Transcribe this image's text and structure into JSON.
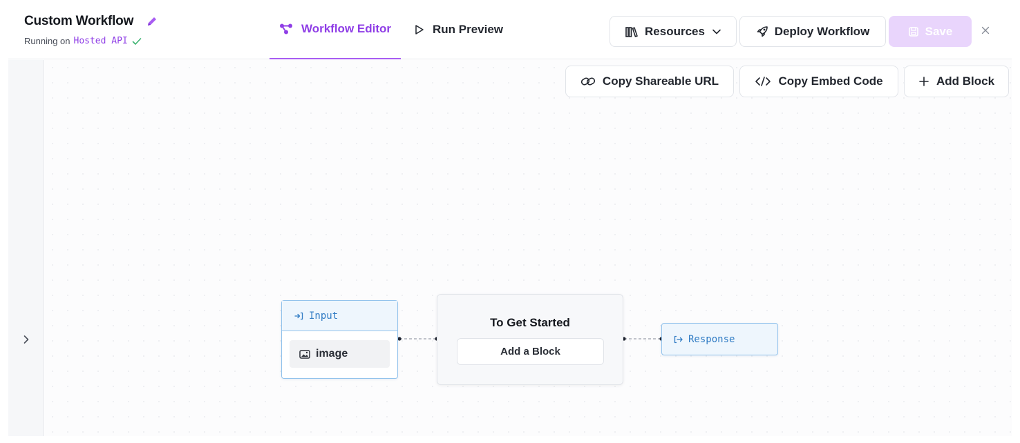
{
  "header": {
    "title": "Custom Workflow",
    "running_prefix": "Running on",
    "running_host": "Hosted API"
  },
  "tabs": [
    {
      "label": "Workflow Editor",
      "active": true
    },
    {
      "label": "Run Preview",
      "active": false
    }
  ],
  "actions": {
    "resources_label": "Resources",
    "deploy_label": "Deploy Workflow",
    "save_label": "Save"
  },
  "toolbar": {
    "share_label": "Copy Shareable URL",
    "embed_label": "Copy Embed Code",
    "add_block_label": "Add Block"
  },
  "nodes": {
    "input": {
      "title": "Input",
      "param": "image"
    },
    "start": {
      "title": "To Get Started",
      "button": "Add a Block"
    },
    "response": {
      "title": "Response"
    }
  },
  "colors": {
    "accent": "#8f3ee6",
    "save_disabled": "#e9d5fc",
    "node_border": "#93c3ec",
    "node_text": "#2f7bc4"
  },
  "icons": [
    "pencil-icon",
    "check-icon",
    "workflow-icon",
    "play-icon",
    "library-icon",
    "chevron-down-icon",
    "rocket-icon",
    "save-icon",
    "close-icon",
    "link-icon",
    "code-icon",
    "plus-icon",
    "chevron-right-icon",
    "input-icon",
    "image-icon",
    "output-icon"
  ]
}
